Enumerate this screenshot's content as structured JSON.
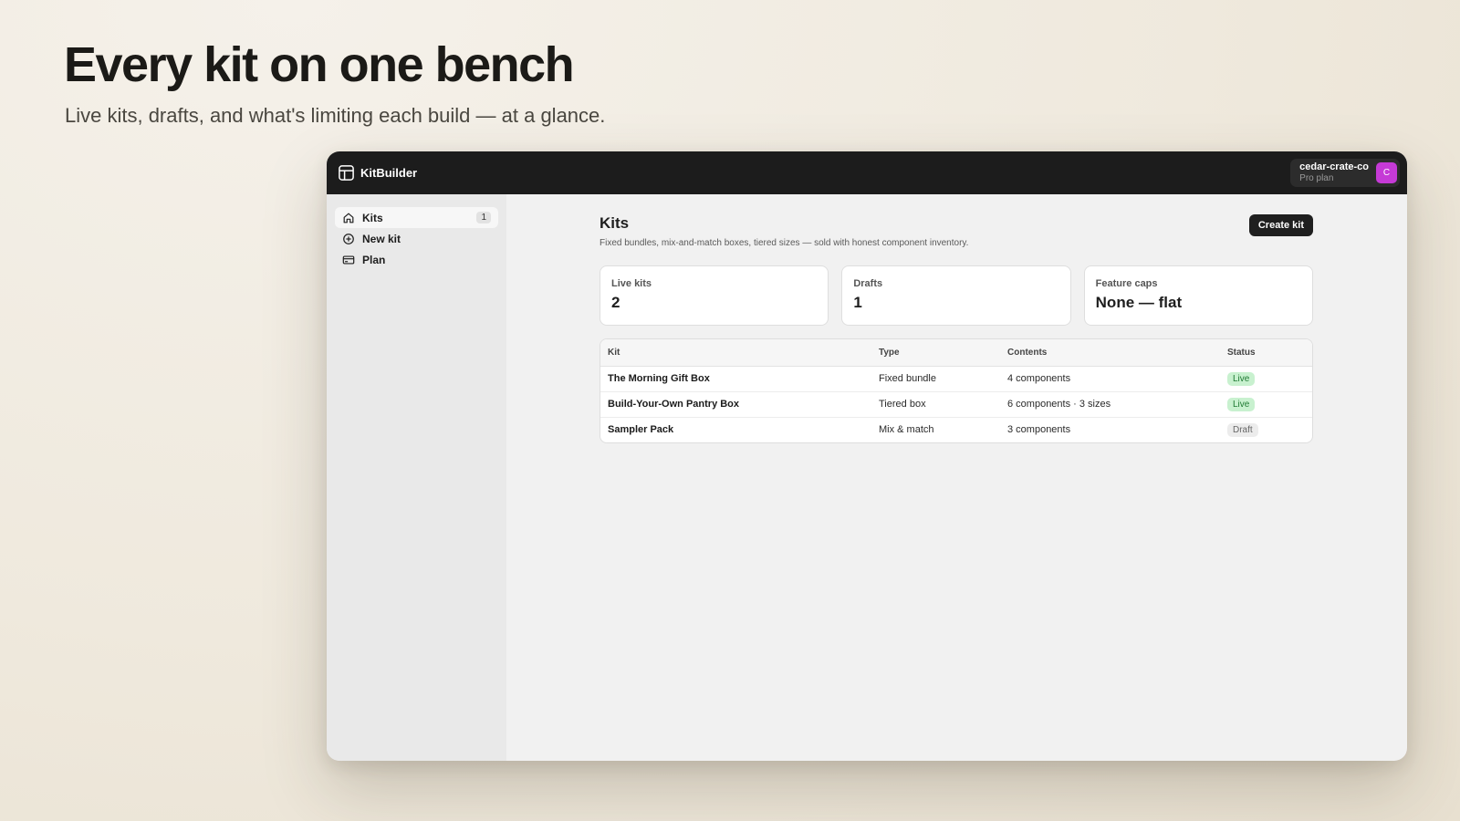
{
  "hero": {
    "title": "Every kit on one bench",
    "subtitle": "Live kits, drafts, and what's limiting each build — at a glance."
  },
  "app": {
    "name": "KitBuilder",
    "account": {
      "name": "cedar-crate-co",
      "plan": "Pro plan",
      "initial": "C",
      "avatar_color": "#c53ad6"
    }
  },
  "sidebar": {
    "items": [
      {
        "label": "Kits",
        "icon": "home-icon",
        "badge": "1",
        "active": true
      },
      {
        "label": "New kit",
        "icon": "plus-circle-icon"
      },
      {
        "label": "Plan",
        "icon": "credit-card-icon"
      }
    ]
  },
  "page": {
    "title": "Kits",
    "description": "Fixed bundles, mix-and-match boxes, tiered sizes — sold with honest component inventory.",
    "create_label": "Create kit"
  },
  "stats": [
    {
      "label": "Live kits",
      "value": "2"
    },
    {
      "label": "Drafts",
      "value": "1"
    },
    {
      "label": "Feature caps",
      "value": "None — flat"
    }
  ],
  "table": {
    "headers": {
      "kit": "Kit",
      "type": "Type",
      "contents": "Contents",
      "status": "Status"
    },
    "rows": [
      {
        "kit": "The Morning Gift Box",
        "type": "Fixed bundle",
        "contents": "4 components",
        "status": "Live"
      },
      {
        "kit": "Build-Your-Own Pantry Box",
        "type": "Tiered box",
        "contents": "6 components · 3 sizes",
        "status": "Live"
      },
      {
        "kit": "Sampler Pack",
        "type": "Mix & match",
        "contents": "3 components",
        "status": "Draft"
      }
    ]
  },
  "colors": {
    "live_bg": "#c8f1cf",
    "live_text": "#1f7a33",
    "draft_bg": "#ececec",
    "topbar": "#1c1c1c"
  }
}
